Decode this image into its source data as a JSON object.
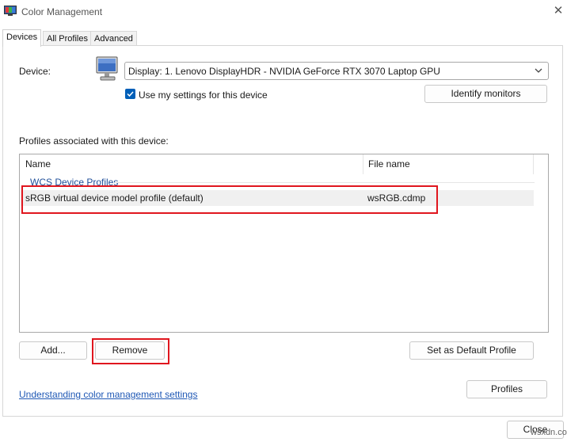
{
  "window": {
    "title": "Color Management"
  },
  "tabs": [
    {
      "label": "Devices",
      "active": true
    },
    {
      "label": "All Profiles",
      "active": false
    },
    {
      "label": "Advanced",
      "active": false
    }
  ],
  "device": {
    "label": "Device:",
    "selected": "Display: 1. Lenovo DisplayHDR - NVIDIA GeForce RTX 3070 Laptop GPU",
    "use_settings_label": "Use my settings for this device",
    "use_settings_checked": true,
    "identify_button": "Identify monitors"
  },
  "profiles": {
    "label": "Profiles associated with this device:",
    "columns": [
      "Name",
      "File name"
    ],
    "group": "WCS Device Profiles",
    "rows": [
      {
        "name": "sRGB virtual device model profile (default)",
        "file": "wsRGB.cdmp"
      }
    ]
  },
  "buttons": {
    "add": "Add...",
    "remove": "Remove",
    "set_default": "Set as Default Profile",
    "profiles": "Profiles",
    "close": "Close"
  },
  "link": "Understanding color management settings",
  "watermark": "wsxdn.com",
  "colors": {
    "accent": "#005fb8",
    "highlight": "#e0161e",
    "link": "#1f58b5"
  }
}
